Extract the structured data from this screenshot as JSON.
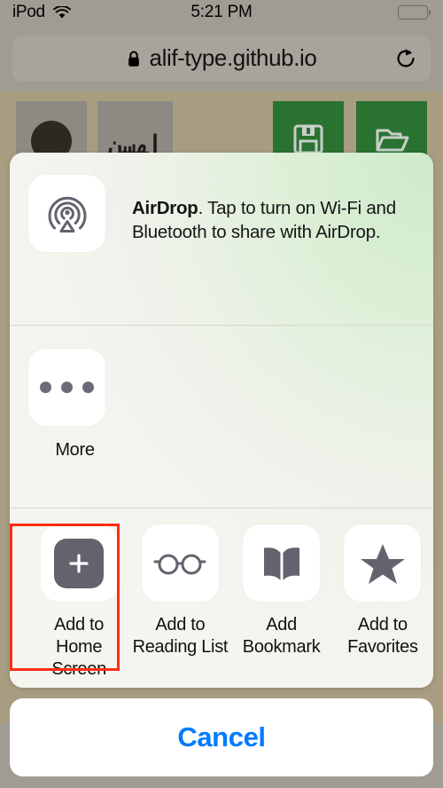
{
  "status_bar": {
    "carrier": "iPod",
    "wifi_icon": "wifi-icon",
    "time": "5:21 PM",
    "battery_icon": "battery-full-icon"
  },
  "browser": {
    "lock_icon": "lock-icon",
    "url": "alif-type.github.io",
    "reload_icon": "reload-icon"
  },
  "page_behind": {
    "background_color": "#a99d81",
    "toolbar_buttons": [
      {
        "name": "glyph-circle-button",
        "icon": "filled-circle-icon",
        "color": "#8d8a83"
      },
      {
        "name": "script-sample-button",
        "label": "اﻬﺳن",
        "color": "#8d8a83"
      },
      {
        "name": "save-button",
        "icon": "floppy-disk-icon",
        "color": "#2a7232"
      },
      {
        "name": "open-button",
        "icon": "folder-icon",
        "color": "#2a7232"
      }
    ]
  },
  "share_sheet": {
    "accent_gradient": "#cdeaca",
    "airdrop": {
      "icon": "airdrop-icon",
      "title": "AirDrop",
      "message": ". Tap to turn on Wi-Fi and Bluetooth to share with AirDrop."
    },
    "apps_row": [
      {
        "icon": "ellipsis-icon",
        "label": "More"
      }
    ],
    "actions": [
      {
        "icon": "plus-square-icon",
        "label": "Add to\nHome Screen",
        "highlighted": true
      },
      {
        "icon": "glasses-icon",
        "label": "Add to\nReading List",
        "highlighted": false
      },
      {
        "icon": "open-book-icon",
        "label": "Add\nBookmark",
        "highlighted": false
      },
      {
        "icon": "star-icon",
        "label": "Add to\nFavorites",
        "highlighted": false
      }
    ],
    "highlight_color": "#ff2d16"
  },
  "cancel": {
    "label": "Cancel",
    "color": "#007aff"
  }
}
